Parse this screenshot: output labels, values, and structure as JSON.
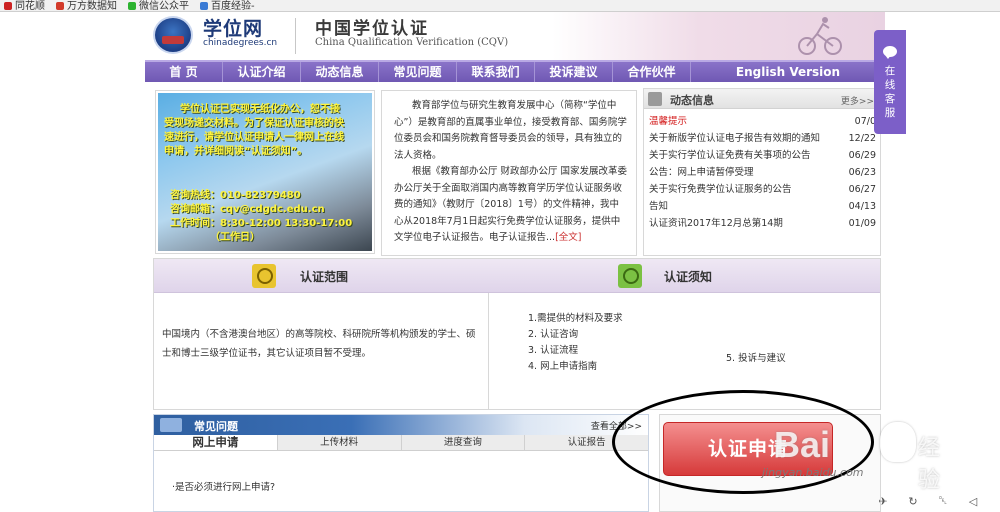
{
  "bookmarks": [
    {
      "label": "同花顺",
      "color": "#cc2222"
    },
    {
      "label": "万方数据知",
      "color": "#d23a2a"
    },
    {
      "label": "微信公众平",
      "color": "#2db330"
    },
    {
      "label": "百度经验-",
      "color": "#3a7bd5"
    }
  ],
  "header": {
    "logo_cn": "学位网",
    "logo_en": "chinadegrees.cn",
    "site_cn": "中国学位认证",
    "site_en": "China Qualification Verification (CQV)"
  },
  "nav": [
    "首  页",
    "认证介绍",
    "动态信息",
    "常见问题",
    "联系我们",
    "投诉建议",
    "合作伙伴",
    "English Version"
  ],
  "notice": {
    "lines": [
      "学位认证已实现无纸化办公，恕不接",
      "受现场递交材料。为了保证认证审核的快",
      "速进行，请学位认证申请人一律网上在线",
      "申请，并详细阅读“认证须知”。"
    ],
    "hotline": "咨询热线：010-82379480",
    "email": "咨询邮箱：cqv@cdgdc.edu.cn",
    "hours": "工作时间：8:30-12:00  13:30-17:00",
    "workday": "（工作日）"
  },
  "intro": {
    "p1": "教育部学位与研究生教育发展中心（简称“学位中心”）是教育部的直属事业单位，接受教育部、国务院学位委员会和国务院教育督导委员会的领导，具有独立的法人资格。",
    "p2": "根据《教育部办公厅 财政部办公厅 国家发展改革委办公厅关于全面取消国内高等教育学历学位认证服务收费的通知》（教财厅〔2018〕1号）的文件精神，我中心从2018年7月1日起实行免费学位认证服务，提供中文学位电子认证报告。电子认证报告...",
    "more": "[全文]"
  },
  "news": {
    "title": "动态信息",
    "more": "更多>>",
    "items": [
      {
        "title": "温馨提示",
        "date": "07/0",
        "hot": true
      },
      {
        "title": "关于新版学位认证电子报告有效期的通知",
        "date": "12/22"
      },
      {
        "title": "关于实行学位认证免费有关事项的公告",
        "date": "06/29"
      },
      {
        "title": "公告：网上申请暂停受理",
        "date": "06/23"
      },
      {
        "title": "关于实行免费学位认证服务的公告",
        "date": "06/27"
      },
      {
        "title": "告知",
        "date": "04/13"
      },
      {
        "title": "认证资讯2017年12月总第14期",
        "date": "01/09"
      }
    ]
  },
  "scope": {
    "title": "认证范围",
    "text": "中国境内（不含港澳台地区）的高等院校、科研院所等机构颁发的学士、硕士和博士三级学位证书，其它认证项目暂不受理。"
  },
  "notes": {
    "title": "认证须知",
    "items": [
      "1.需提供的材料及要求",
      "2. 认证咨询",
      "3. 认证流程",
      "4. 网上申请指南"
    ],
    "extra": "5. 投诉与建议"
  },
  "faq": {
    "title": "常见问题",
    "more": "查看全部>>",
    "tabs": [
      "网上申请",
      "上传材料",
      "进度查询",
      "认证报告"
    ],
    "question": "·是否必须进行网上申请?"
  },
  "apply": {
    "label": "认证申请"
  },
  "service": {
    "label": "在线客服"
  },
  "watermark": {
    "bai": "Bai",
    "exp": "经验",
    "url": "jingyan.baidu.com"
  },
  "bottom_icons": [
    "rocket-icon",
    "refresh-icon",
    "trash-icon",
    "speaker-icon"
  ]
}
